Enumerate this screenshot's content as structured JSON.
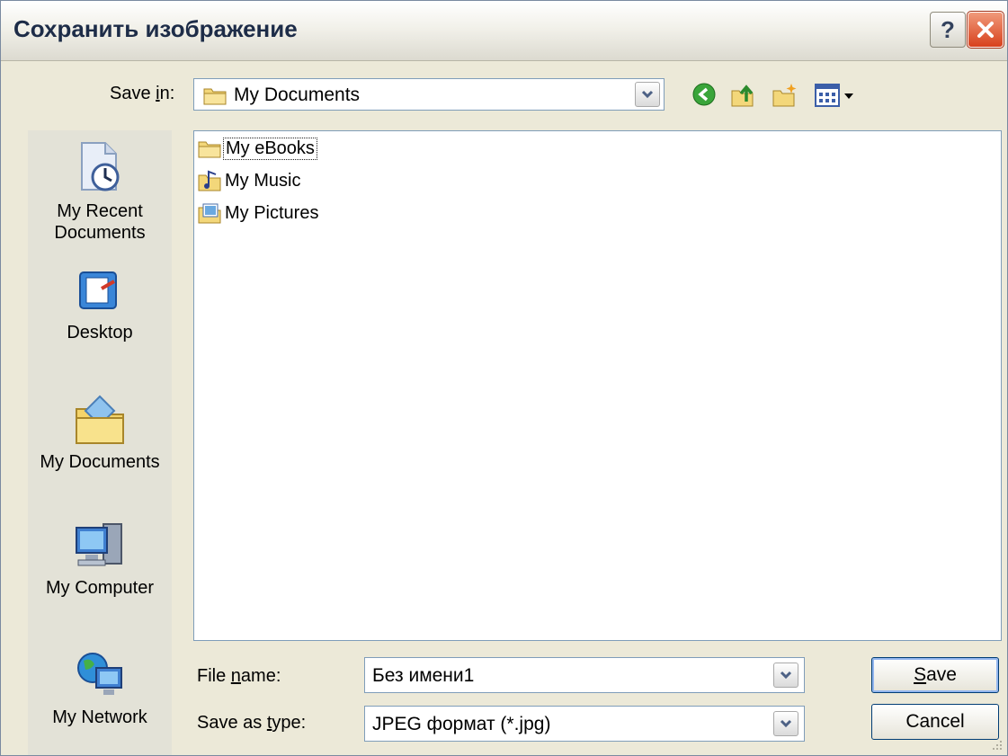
{
  "dialog": {
    "title": "Сохранить изображение",
    "title_color": "#1d2c48",
    "help_label": "?"
  },
  "save_in": {
    "label_prefix": "Save ",
    "label_hotkey": "i",
    "label_suffix": "n:",
    "value": "My Documents",
    "icon": "folder-icon"
  },
  "toolbar": {
    "icons": [
      "back-icon",
      "up-folder-icon",
      "new-folder-icon",
      "views-menu-icon"
    ]
  },
  "places_bar": {
    "items": [
      {
        "label": "My Recent Documents",
        "icon": "recent-documents-icon"
      },
      {
        "label": "Desktop",
        "icon": "desktop-icon"
      },
      {
        "label": "My Documents",
        "icon": "my-documents-icon"
      },
      {
        "label": "My Computer",
        "icon": "my-computer-icon"
      },
      {
        "label": "My Network",
        "icon": "my-network-icon"
      }
    ]
  },
  "files": [
    {
      "name": "My eBooks",
      "icon": "folder-icon",
      "focused": true
    },
    {
      "name": "My Music",
      "icon": "music-folder-icon",
      "focused": false
    },
    {
      "name": "My Pictures",
      "icon": "pictures-folder-icon",
      "focused": false
    }
  ],
  "file_name": {
    "label_prefix": "File ",
    "label_hotkey": "n",
    "label_suffix": "ame:",
    "value": "Без имени1"
  },
  "save_as_type": {
    "label_prefix": "Save as ",
    "label_hotkey": "t",
    "label_suffix": "ype:",
    "value": "JPEG формат (*.jpg)"
  },
  "buttons": {
    "save_hotkey": "S",
    "save_rest": "ave",
    "cancel": "Cancel"
  },
  "colors": {
    "window_bg": "#ece9d8",
    "field_border": "#7f9db9",
    "close_red": "#d8411d"
  }
}
